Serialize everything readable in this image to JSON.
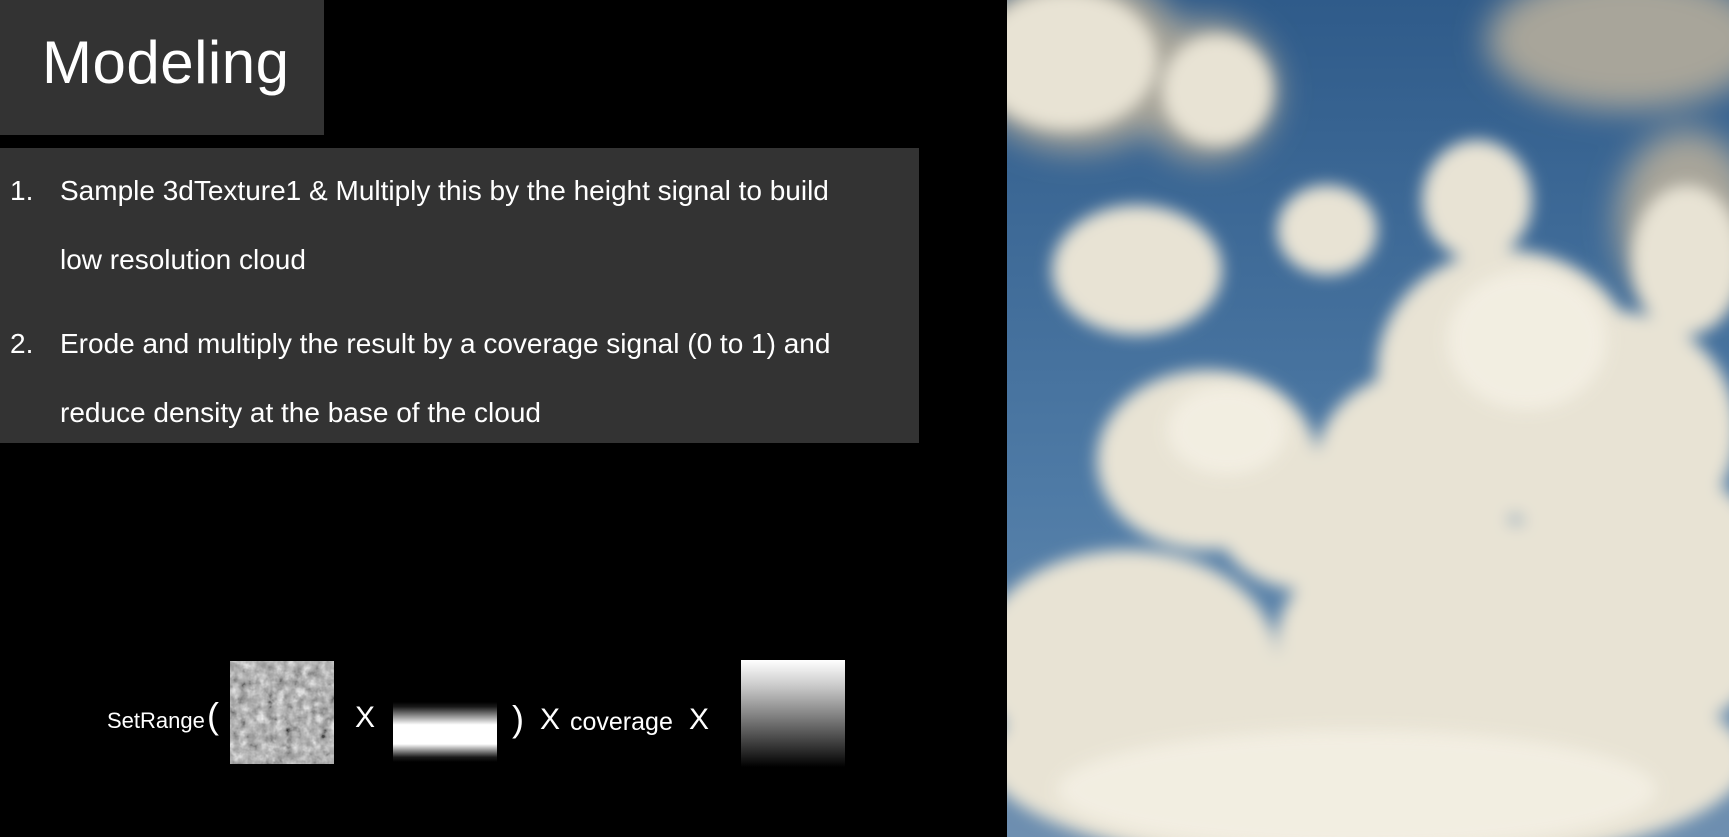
{
  "slide": {
    "title": "Modeling"
  },
  "steps": [
    {
      "number": "1.",
      "lines": [
        "Sample 3dTexture1 & Multiply this by the height signal to build",
        "low resolution cloud"
      ]
    },
    {
      "number": "2.",
      "lines": [
        "Erode and multiply the result by a coverage signal (0 to 1) and",
        "reduce density at the base of the cloud"
      ]
    }
  ],
  "formula": {
    "setrange": "SetRange",
    "open_paren": "(",
    "times_1": "X",
    "close_paren": ")",
    "times_2": "X",
    "coverage": "coverage",
    "times_3": "X"
  },
  "colors": {
    "background": "#000000",
    "panel": "#333333",
    "text": "#ffffff",
    "sky": "#3d6a99"
  },
  "icons": {
    "noise_texture": "3d-noise-texture-swatch",
    "height_signal": "height-gradient-swatch",
    "coverage_signal": "coverage-gradient-swatch",
    "photo": "cumulus-cloud-photo"
  }
}
